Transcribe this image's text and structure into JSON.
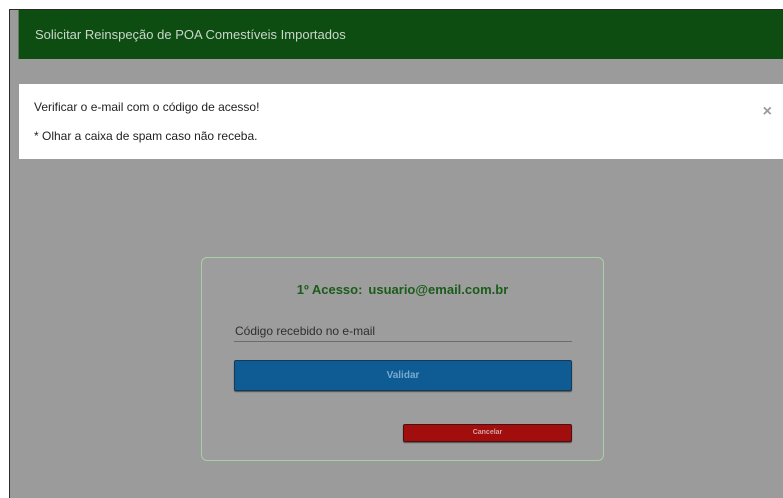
{
  "header": {
    "title": "Solicitar Reinspeção de POA Comestíveis Importados"
  },
  "alert": {
    "message": "Verificar o e-mail com o código de acesso!",
    "note": "* Olhar a caixa de spam caso não receba.",
    "close_symbol": "×"
  },
  "card": {
    "title_label": "1º Acesso:",
    "email": "usuario@email.com.br",
    "code_placeholder": "Código recebido no e-mail",
    "code_value": "",
    "validate_label": "Validar",
    "cancel_label": "Cancelar"
  },
  "colors": {
    "header_bg": "#0d4d12",
    "overlay_bg": "#9b9b9b",
    "title_green": "#1a5c1a",
    "validate_bg": "#0e5c93",
    "cancel_bg": "#a20d0d"
  }
}
